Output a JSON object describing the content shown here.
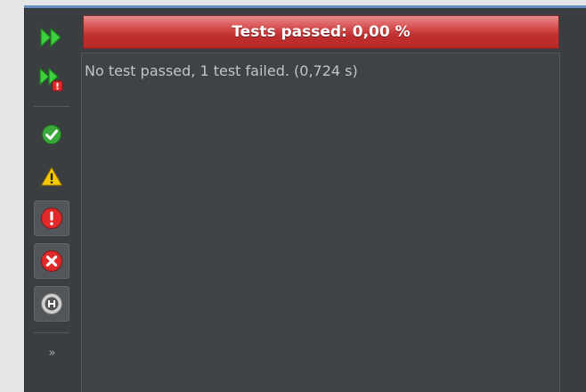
{
  "progress": {
    "label": "Tests passed: 0,00 %",
    "status_color": "#c83a3a",
    "passed_fraction": 0.0
  },
  "output": {
    "message": "No test passed, 1 test failed. (0,724 s)"
  },
  "toolbar": {
    "buttons": [
      {
        "name": "rerun-all",
        "icon": "double-play-icon"
      },
      {
        "name": "rerun-failed",
        "icon": "double-play-failed-icon"
      },
      {
        "name": "show-passed",
        "icon": "check-circle-icon"
      },
      {
        "name": "show-warnings",
        "icon": "warning-triangle-icon"
      },
      {
        "name": "show-failures",
        "icon": "exclamation-circle-icon"
      },
      {
        "name": "show-errors",
        "icon": "x-circle-icon"
      },
      {
        "name": "show-skipped",
        "icon": "skip-circle-icon"
      }
    ],
    "more_label": "»"
  },
  "colors": {
    "panel": "#3b3e41",
    "accent_play": "#3cc43c",
    "ok": "#3aa83a",
    "warn": "#f2c200",
    "fail": "#d62c2c",
    "skip": "#c9c9c9"
  }
}
